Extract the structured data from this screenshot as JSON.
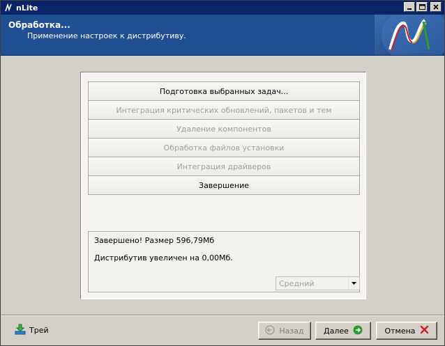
{
  "window": {
    "title": "nLite",
    "controls": {
      "minimize": "_",
      "maximize": "□",
      "close": "✕"
    }
  },
  "header": {
    "title": "Обработка...",
    "subtitle": "Применение настроек к дистрибутиву."
  },
  "tasks": [
    {
      "label": "Подготовка выбранных задач...",
      "active": true
    },
    {
      "label": "Интеграция критических обновлений, пакетов и тем",
      "active": false
    },
    {
      "label": "Удаление компонентов",
      "active": false
    },
    {
      "label": "Обработка файлов установки",
      "active": false
    },
    {
      "label": "Интеграция драйверов",
      "active": false
    },
    {
      "label": "Завершение",
      "active": true
    }
  ],
  "log": {
    "line1": "Завершено! Размер 596,79Мб",
    "line2": "Дистрибутив увеличен на 0,00Мб."
  },
  "priority": {
    "selected": "Средний"
  },
  "footer": {
    "tray_label": "Трей",
    "back_label": "Назад",
    "next_label": "Далее",
    "cancel_label": "Отмена"
  },
  "colors": {
    "header_bg": "#1f4f92",
    "titlebar_bg": "#0a246a",
    "next_icon": "#2e9a2e",
    "cancel_icon": "#cc2020"
  },
  "icons": {
    "app": "nlite-logo-icon",
    "tray": "tray-download-icon",
    "back": "arrow-left-circle-icon",
    "next": "arrow-right-circle-icon",
    "cancel": "red-x-icon",
    "combo": "chevron-down-icon"
  }
}
